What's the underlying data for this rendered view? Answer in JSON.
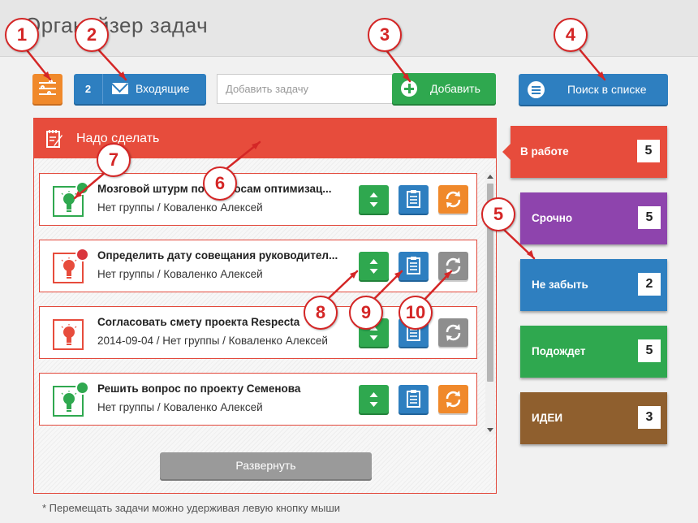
{
  "app": {
    "title": "Органайзер задач"
  },
  "toolbar": {
    "settings_icon": "settings-sliders-icon",
    "inbox": {
      "count": "2",
      "label": "Входящие",
      "icon": "envelope-icon"
    },
    "add_task_placeholder": "Добавить задачу",
    "add_button_label": "Добавить",
    "search_button_label": "Поиск в списке"
  },
  "panel": {
    "title": "Надо сделать",
    "expand_label": "Развернуть",
    "tasks": [
      {
        "title": "Мозговой штурм по вопросам оптимизац...",
        "meta": "Нет группы / Коваленко Алексей",
        "bulb_color": "#2fa84f",
        "status_color": "#2fa84f",
        "cycle_color": "#f0892b"
      },
      {
        "title": "Определить дату совещания руководител...",
        "meta": "Нет группы / Коваленко Алексей",
        "bulb_color": "#e74c3c",
        "status_color": "#d9363e",
        "cycle_color": "#8e8e8e"
      },
      {
        "title": "Согласовать смету проекта Respecta",
        "meta": "2014-09-04 / Нет группы / Коваленко Алексей",
        "bulb_color": "#e74c3c",
        "status_color": "",
        "cycle_color": "#8e8e8e"
      },
      {
        "title": "Решить вопрос по проекту Семенова",
        "meta": "Нет группы / Коваленко Алексей",
        "bulb_color": "#2fa84f",
        "status_color": "#2fa84f",
        "cycle_color": "#f0892b"
      }
    ]
  },
  "footnote": "* Перемещать задачи можно удерживая левую кнопку мыши",
  "categories": [
    {
      "label": "В работе",
      "count": "5",
      "color": "#e74c3c"
    },
    {
      "label": "Срочно",
      "count": "5",
      "color": "#8e44ad"
    },
    {
      "label": "Не забыть",
      "count": "2",
      "color": "#2e7fc0"
    },
    {
      "label": "Подождет",
      "count": "5",
      "color": "#2fa84f"
    },
    {
      "label": "ИДЕИ",
      "count": "3",
      "color": "#8f5f2e"
    }
  ],
  "callouts": [
    "1",
    "2",
    "3",
    "4",
    "5",
    "6",
    "7",
    "8",
    "9",
    "10"
  ],
  "colors": {
    "callout_red": "#d42626",
    "panel_red": "#e74c3c",
    "accent_blue": "#2e7fc0",
    "accent_green": "#2fa84f",
    "accent_orange": "#f0892b"
  }
}
